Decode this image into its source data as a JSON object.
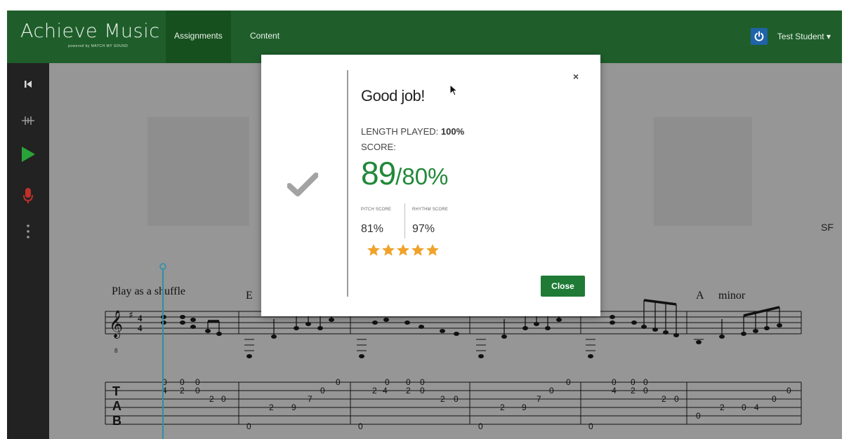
{
  "app": {
    "logo_text": "Achieve Music",
    "logo_sub": "powered by MATCH MY SOUND"
  },
  "nav": {
    "tabs": [
      {
        "label": "Assignments",
        "active": true
      },
      {
        "label": "Content",
        "active": false
      }
    ],
    "user_name": "Test Student ▾"
  },
  "toolbar": {
    "icons": [
      "skip-back-icon",
      "metronome-icon",
      "play-icon",
      "microphone-icon",
      "more-vertical-icon"
    ]
  },
  "score": {
    "instruction": "Play as a shuffle",
    "chords": [
      "E",
      "A",
      "minor"
    ],
    "side_label": "SF"
  },
  "modal": {
    "title": "Good job!",
    "length_label": "LENGTH PLAYED:",
    "length_value": "100%",
    "score_label": "SCORE:",
    "score_value": "89",
    "score_target": "/80%",
    "pitch_label": "PITCH SCORE",
    "pitch_value": "81%",
    "rhythm_label": "RHYTHM SCORE",
    "rhythm_value": "97%",
    "stars": 5,
    "close_label": "Close",
    "close_x": "×"
  },
  "colors": {
    "nav_bg": "#1f5e2b",
    "accent_green": "#22883a",
    "button_green": "#1e7a35",
    "star": "#f0a22a",
    "record_red": "#c0302a",
    "play_green": "#29a338",
    "cursor_line": "#2f8fa8"
  }
}
